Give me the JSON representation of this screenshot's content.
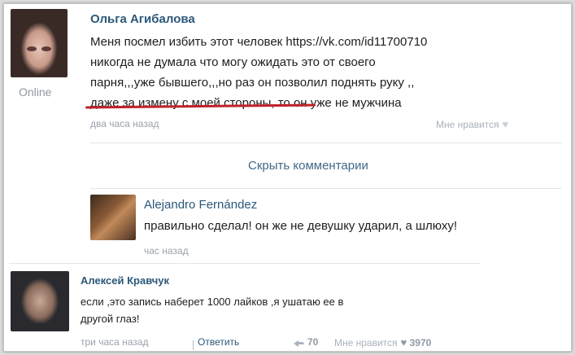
{
  "post": {
    "author": "Ольга Агибалова",
    "status": "Online",
    "lines": [
      "Меня посмел избить этот человек https://vk.com/id11700710",
      "никогда не думала что могу ожидать это от своего",
      "парня,,,уже бывшего,,,но раз он позволил поднять руку ,,",
      "даже за измену с моей стороны, то он уже не мужчина"
    ],
    "time": "два часа назад",
    "like_label": "Мне нравится",
    "underline_color": "#c0222a"
  },
  "hide_comments_label": "Скрыть комментарии",
  "comments": [
    {
      "author": "Alejandro Fernández",
      "text": "правильно сделал! он же не девушку ударил, а шлюху!",
      "time": "час назад"
    },
    {
      "author": "Алексей Кравчук",
      "lines": [
        "если ,это запись наберет 1000 лайков ,я ушатаю ее в",
        "другой глаз!"
      ],
      "time": "три часа назад",
      "reply_label": "Ответить",
      "shares": "70",
      "like_label": "Мне нравится",
      "likes": "3970"
    }
  ],
  "colors": {
    "link": "#2b587a",
    "meta": "#9aa2ad"
  }
}
